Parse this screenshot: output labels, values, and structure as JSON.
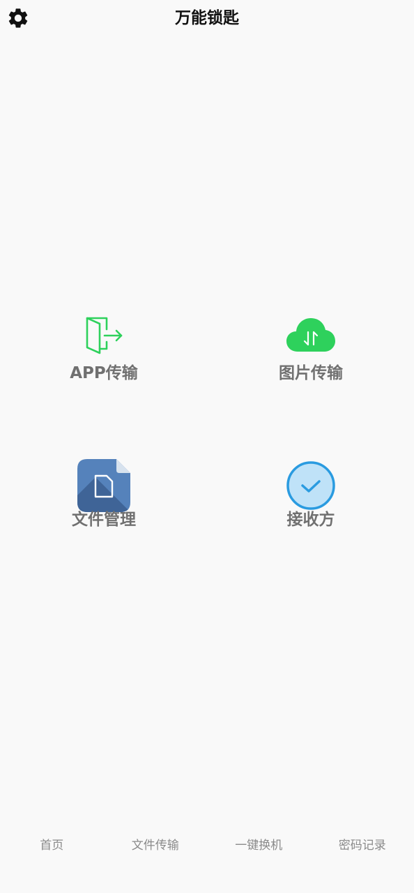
{
  "header": {
    "title": "万能锁匙",
    "settings_icon": "gear-icon"
  },
  "features": [
    {
      "id": "app",
      "label": "APP传输",
      "icon": "door-exit-icon",
      "color": "#2ed15c"
    },
    {
      "id": "image",
      "label": "图片传输",
      "icon": "cloud-transfer-icon",
      "color": "#2ed15c"
    },
    {
      "id": "file",
      "label": "文件管理",
      "icon": "document-icon",
      "color": "#4f7bb3"
    },
    {
      "id": "receiver",
      "label": "接收方",
      "icon": "check-circle-icon",
      "color": "#2a9be0"
    }
  ],
  "tabs": [
    {
      "label": "首页"
    },
    {
      "label": "文件传输"
    },
    {
      "label": "一键换机"
    },
    {
      "label": "密码记录"
    }
  ]
}
